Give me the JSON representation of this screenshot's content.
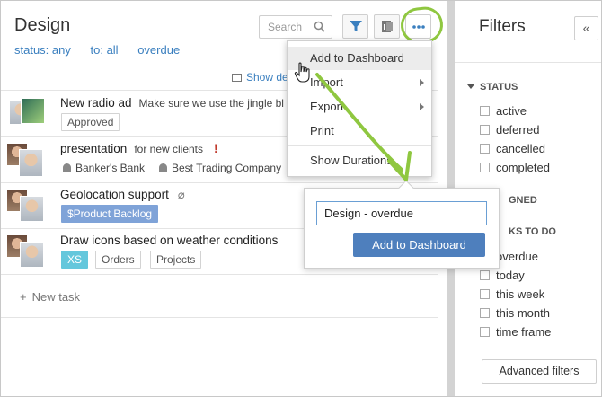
{
  "page": {
    "title": "Design",
    "filter_status": "status: any",
    "filter_to": "to: all",
    "filter_overdue": "overdue",
    "search_placeholder": "Search",
    "show_details": "Show de",
    "new_task": "New task"
  },
  "tasks": [
    {
      "title": "New radio ad",
      "sub": "Make sure we use the jingle bl",
      "tags": [
        "Approved"
      ]
    },
    {
      "title": "presentation",
      "sub": "for new clients",
      "people": [
        "Banker's Bank",
        "Best Trading Company"
      ]
    },
    {
      "title": "Geolocation support",
      "tags": [
        "$Product Backlog"
      ]
    },
    {
      "title": "Draw icons based on weather conditions",
      "tags": [
        "XS",
        "Orders",
        "Projects"
      ]
    }
  ],
  "menu": {
    "items": [
      "Add to Dashboard",
      "Import",
      "Export",
      "Print",
      "Show Durations"
    ]
  },
  "popup": {
    "input_value": "Design - overdue",
    "button": "Add to Dashboard"
  },
  "filters": {
    "title": "Filters",
    "collapse": "«",
    "status_header": "STATUS",
    "status_items": [
      "active",
      "deferred",
      "cancelled",
      "completed"
    ],
    "assigned_header": "GNED",
    "tasks_header": "KS TO DO",
    "tasks_items": [
      "overdue",
      "today",
      "this week",
      "this month",
      "time frame"
    ],
    "advanced": "Advanced filters"
  },
  "colors": {
    "link": "#3a7fbf",
    "primary_button": "#4e7fbd",
    "highlight_green": "#8fc740",
    "product_backlog_tag": "#7fa3d8",
    "size_tag": "#64c7dc"
  }
}
